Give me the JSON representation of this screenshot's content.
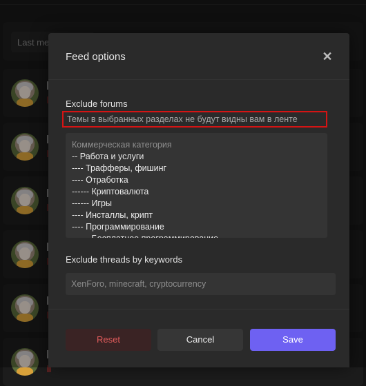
{
  "background": {
    "search_placeholder": "Last me",
    "rows": 6
  },
  "modal": {
    "title": "Feed options",
    "close_icon": "close-icon",
    "exclude_forums_label": "Exclude forums",
    "exclude_forums_hint": "Темы в выбранных разделах не будут видны вам в ленте",
    "forum_items": [
      {
        "label": "Коммерческая категория",
        "type": "category"
      },
      {
        "label": "-- Работа и услуги",
        "type": "forum"
      },
      {
        "label": "---- Трафферы, фишинг",
        "type": "forum"
      },
      {
        "label": "---- Отработка",
        "type": "forum"
      },
      {
        "label": "------ Криптовалюта",
        "type": "forum"
      },
      {
        "label": "------ Игры",
        "type": "forum"
      },
      {
        "label": "---- Инсталлы, крипт",
        "type": "forum"
      },
      {
        "label": "---- Программирование",
        "type": "forum"
      },
      {
        "label": "------ Бесплатное программирование",
        "type": "forum"
      }
    ],
    "exclude_threads_label": "Exclude threads by keywords",
    "keywords_placeholder": "XenForo, minecraft, cryptocurrency",
    "buttons": {
      "reset": "Reset",
      "cancel": "Cancel",
      "save": "Save"
    }
  },
  "colors": {
    "accent": "#6e61f2",
    "danger": "#e05b5b",
    "highlight_border": "#d41414"
  }
}
